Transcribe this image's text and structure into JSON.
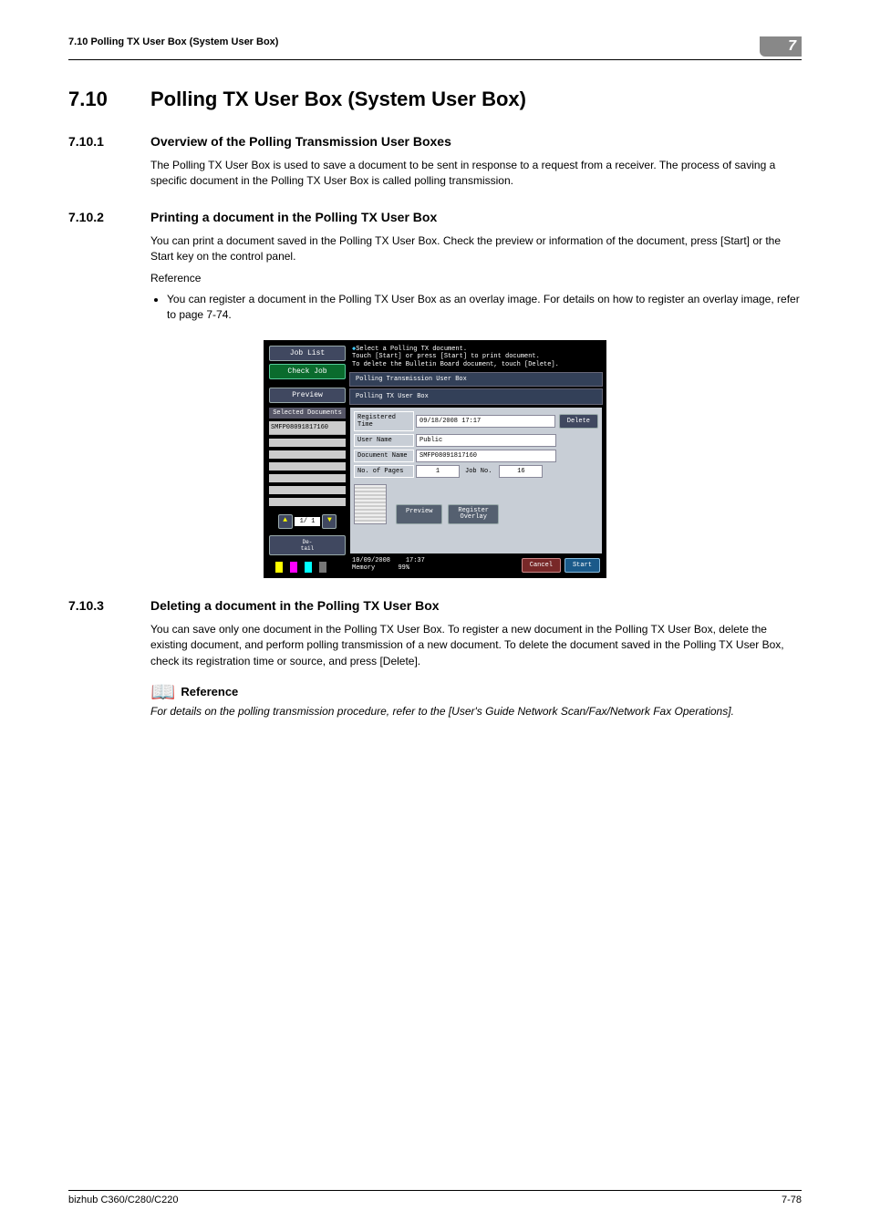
{
  "header": {
    "left": "7.10    Polling TX User Box (System User Box)",
    "chapter": "7"
  },
  "s710": {
    "num": "7.10",
    "title": "Polling TX User Box (System User Box)"
  },
  "s7101": {
    "num": "7.10.1",
    "title": "Overview of the Polling Transmission User Boxes",
    "p1": "The Polling TX User Box is used to save a document to be sent in response to a request from a receiver. The process of saving a specific document in the Polling TX User Box is called polling transmission."
  },
  "s7102": {
    "num": "7.10.2",
    "title": "Printing a document in the Polling TX User Box",
    "p1": "You can print a document saved in the Polling TX User Box. Check the preview or information of the document, press [Start] or the Start key on the control panel.",
    "ref": "Reference",
    "b1": "You can register a document in the Polling TX User Box as an overlay image. For details on how to register an overlay image, refer to page 7-74."
  },
  "s7103": {
    "num": "7.10.3",
    "title": "Deleting a document in the Polling TX User Box",
    "p1": "You can save only one document in the Polling TX User Box. To register a new document in the Polling TX User Box, delete the existing document, and perform polling transmission of a new document. To delete the document saved in the Polling TX User Box, check its registration time or source, and press [Delete].",
    "refhead": "Reference",
    "ref": "For details on the polling transmission procedure, refer to the [User's Guide Network Scan/Fax/Network Fax Operations]."
  },
  "screenshot": {
    "left": {
      "joblist": "Job List",
      "checkjob": "Check Job",
      "preview": "Preview",
      "seldocs": "Selected Documents",
      "doc": "SMFP08091817160",
      "page": "1/  1",
      "detail": "De-\ntail"
    },
    "msg": {
      "l1": "Select a Polling TX document.",
      "l2": "Touch [Start] or press [Start] to print document.",
      "l3": "To delete the Bulletin Board document, touch [Delete]."
    },
    "tab1": "Polling Transmission User Box",
    "tab2": "Polling TX User Box",
    "info": {
      "regtime_l": "Registered\nTime",
      "regtime_v": "09/18/2008 17:17",
      "user_l": "User Name",
      "user_v": "Public",
      "doc_l": "Document Name",
      "doc_v": "SMFP08091817160",
      "pages_l": "No. of Pages",
      "pages_v": "1",
      "job_l": "Job No.",
      "job_v": "16"
    },
    "delete": "Delete",
    "previewbtn": "Preview",
    "overlay": "Register\nOverlay",
    "footer": {
      "date": "10/09/2008",
      "time": "17:37",
      "mem": "Memory",
      "memv": "99%",
      "cancel": "Cancel",
      "start": "Start"
    }
  },
  "footer": {
    "left": "bizhub C360/C280/C220",
    "right": "7-78"
  }
}
